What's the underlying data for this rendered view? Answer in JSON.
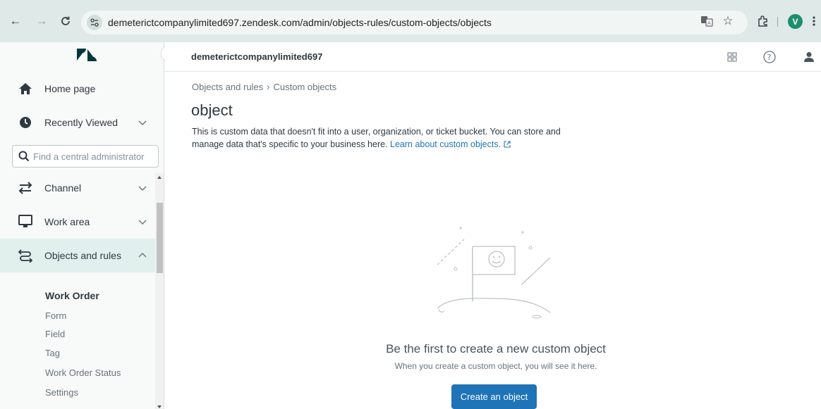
{
  "browser": {
    "url": "demeterictcompanylimited697.zendesk.com/admin/objects-rules/custom-objects/objects",
    "profile_initial": "V"
  },
  "sidebar": {
    "items": [
      {
        "label": "Home page",
        "icon": "home-icon"
      },
      {
        "label": "Recently Viewed",
        "icon": "clock-icon"
      },
      {
        "label": "Channel",
        "icon": "channel-arrows-icon"
      },
      {
        "label": "Work area",
        "icon": "monitor-icon"
      },
      {
        "label": "Objects and rules",
        "icon": "objects-rules-icon"
      }
    ],
    "search_placeholder": "Find a central administrator",
    "subitems": [
      {
        "label": "Work Order"
      },
      {
        "label": "Form"
      },
      {
        "label": "Field"
      },
      {
        "label": "Tag"
      },
      {
        "label": "Work Order Status"
      },
      {
        "label": "Settings"
      }
    ]
  },
  "header": {
    "account": "demeterictcompanylimited697"
  },
  "main": {
    "breadcrumb": {
      "parent": "Objects and rules",
      "separator": "›",
      "current": "Custom objects"
    },
    "title": "object",
    "description": "This is custom data that doesn't fit into a user, organization, or ticket bucket. You can store and manage data that's specific to your business here.",
    "learn_link": "Learn about custom objects.",
    "empty_title": "Be the first to create a new custom object",
    "empty_subtitle": "When you create a custom object, you will see it here.",
    "create_button": "Create an object"
  },
  "colors": {
    "primary": "#1f73b7",
    "active_nav": "#e1f0ed",
    "browser_bar": "#dfe9e7"
  }
}
